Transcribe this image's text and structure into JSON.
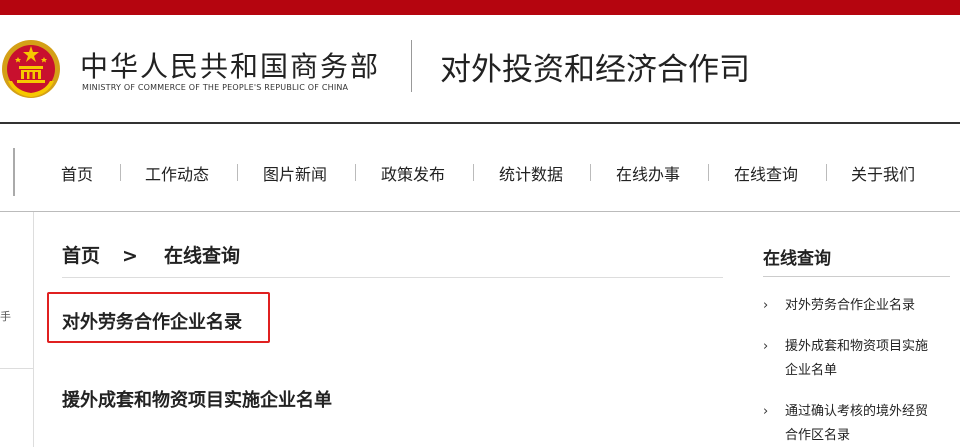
{
  "header": {
    "ministry_cn": "中华人民共和国商务部",
    "ministry_en": "MINISTRY OF COMMERCE OF THE PEOPLE'S REPUBLIC OF CHINA",
    "department": "对外投资和经济合作司"
  },
  "nav": {
    "items": [
      {
        "label": "首页"
      },
      {
        "label": "工作动态"
      },
      {
        "label": "图片新闻"
      },
      {
        "label": "政策发布"
      },
      {
        "label": "统计数据"
      },
      {
        "label": "在线办事"
      },
      {
        "label": "在线查询"
      },
      {
        "label": "关于我们"
      }
    ]
  },
  "left_strip": {
    "glyph": "手"
  },
  "breadcrumb": {
    "home": "首页",
    "separator": ">",
    "current": "在线查询"
  },
  "main": {
    "items": [
      {
        "label": "对外劳务合作企业名录",
        "highlighted": true
      },
      {
        "label": "援外成套和物资项目实施企业名单",
        "highlighted": false
      }
    ]
  },
  "sidebar": {
    "title": "在线查询",
    "items": [
      {
        "line1": "对外劳务合作企业名录",
        "line2": ""
      },
      {
        "line1": "援外成套和物资项目实施",
        "line2": "企业名单"
      },
      {
        "line1": "通过确认考核的境外经贸",
        "line2": "合作区名录"
      }
    ]
  },
  "colors": {
    "top_bar": "#b5050f",
    "highlight_border": "#e02020",
    "text": "#222222"
  }
}
